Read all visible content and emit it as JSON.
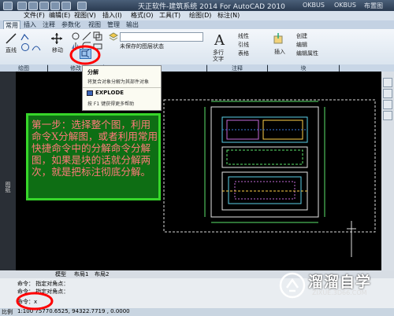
{
  "title_bar": {
    "title": "天正软件-建筑系统 2014  For AutoCAD 2010",
    "right_labels": [
      "OKBUS",
      "OKBUS",
      "布置图"
    ]
  },
  "menu": [
    "文件(F)",
    "编辑(E)",
    "视图(V)",
    "插入(I)",
    "格式(O)",
    "工具(T)",
    "绘图(D)",
    "标注(N)"
  ],
  "ribbon_tabs": [
    "常用",
    "插入",
    "注释",
    "参数化",
    "视图",
    "管理",
    "输出"
  ],
  "ribbon": {
    "draw_tools": [
      "直线",
      "移动"
    ],
    "layer_state": "未保存的图层状态",
    "text_tool": "多行\n文字",
    "annot_items": [
      "线性",
      "引线",
      "表格"
    ],
    "insert_tool": "插入",
    "block_items": [
      "创建",
      "编辑",
      "编辑属性"
    ],
    "groups": [
      "绘图",
      "修改",
      "图层",
      "注释",
      "块"
    ]
  },
  "tooltip": {
    "title": "分解",
    "desc": "将复合对象分解为其部件对象",
    "command": "EXPLODE",
    "help": "按 F1 键获得更多帮助"
  },
  "note": "第一步：选择整个图，利用命令X分解图，或者利用常用快捷命令中的分解命令分解图，如果是块的话就分解两次，就是把标注彻底分解。",
  "left_panel_label": "图纸",
  "layout_tabs": [
    "模型",
    "布局1",
    "布局2"
  ],
  "command": {
    "lines": [
      "命令：  指定对角点：",
      "命令：  指定对角点："
    ],
    "prompt": "命令：x"
  },
  "status": {
    "label": "比例",
    "coords": "1:100  75770.6525,  94322.7719 ,  0.0000"
  },
  "watermark": {
    "name": "溜溜自学",
    "url": "ZIXUE.3D66.COM"
  },
  "colors": {
    "annotation_border": "#37d62a",
    "annotation_bg": "#0e6e14",
    "annotation_text": "#ff7a7a",
    "highlight_ellipse": "#ff0000"
  }
}
